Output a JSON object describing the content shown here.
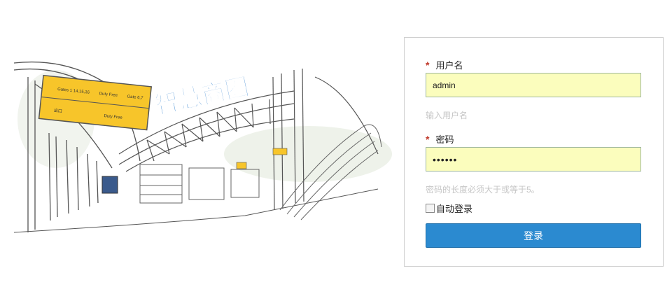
{
  "logo_text": "智慧商圈",
  "illustration": {
    "signs": [
      "Gates 1 14,15,16",
      "Duty Free",
      "Gate 6,7",
      "出口",
      "Duty Free"
    ]
  },
  "login": {
    "username_label": "用户名",
    "username_value": "admin",
    "username_hint": "输入用户名",
    "password_label": "密码",
    "password_value": "••••••",
    "password_hint": "密码的长度必须大于或等于5。",
    "required_mark": "*",
    "remember_label": "自动登录",
    "remember_checked": false,
    "submit_label": "登录"
  },
  "colors": {
    "button": "#2b8ad0",
    "input_bg": "#fbfdbd",
    "logo": "#3a86d1",
    "required": "#c0392b"
  }
}
